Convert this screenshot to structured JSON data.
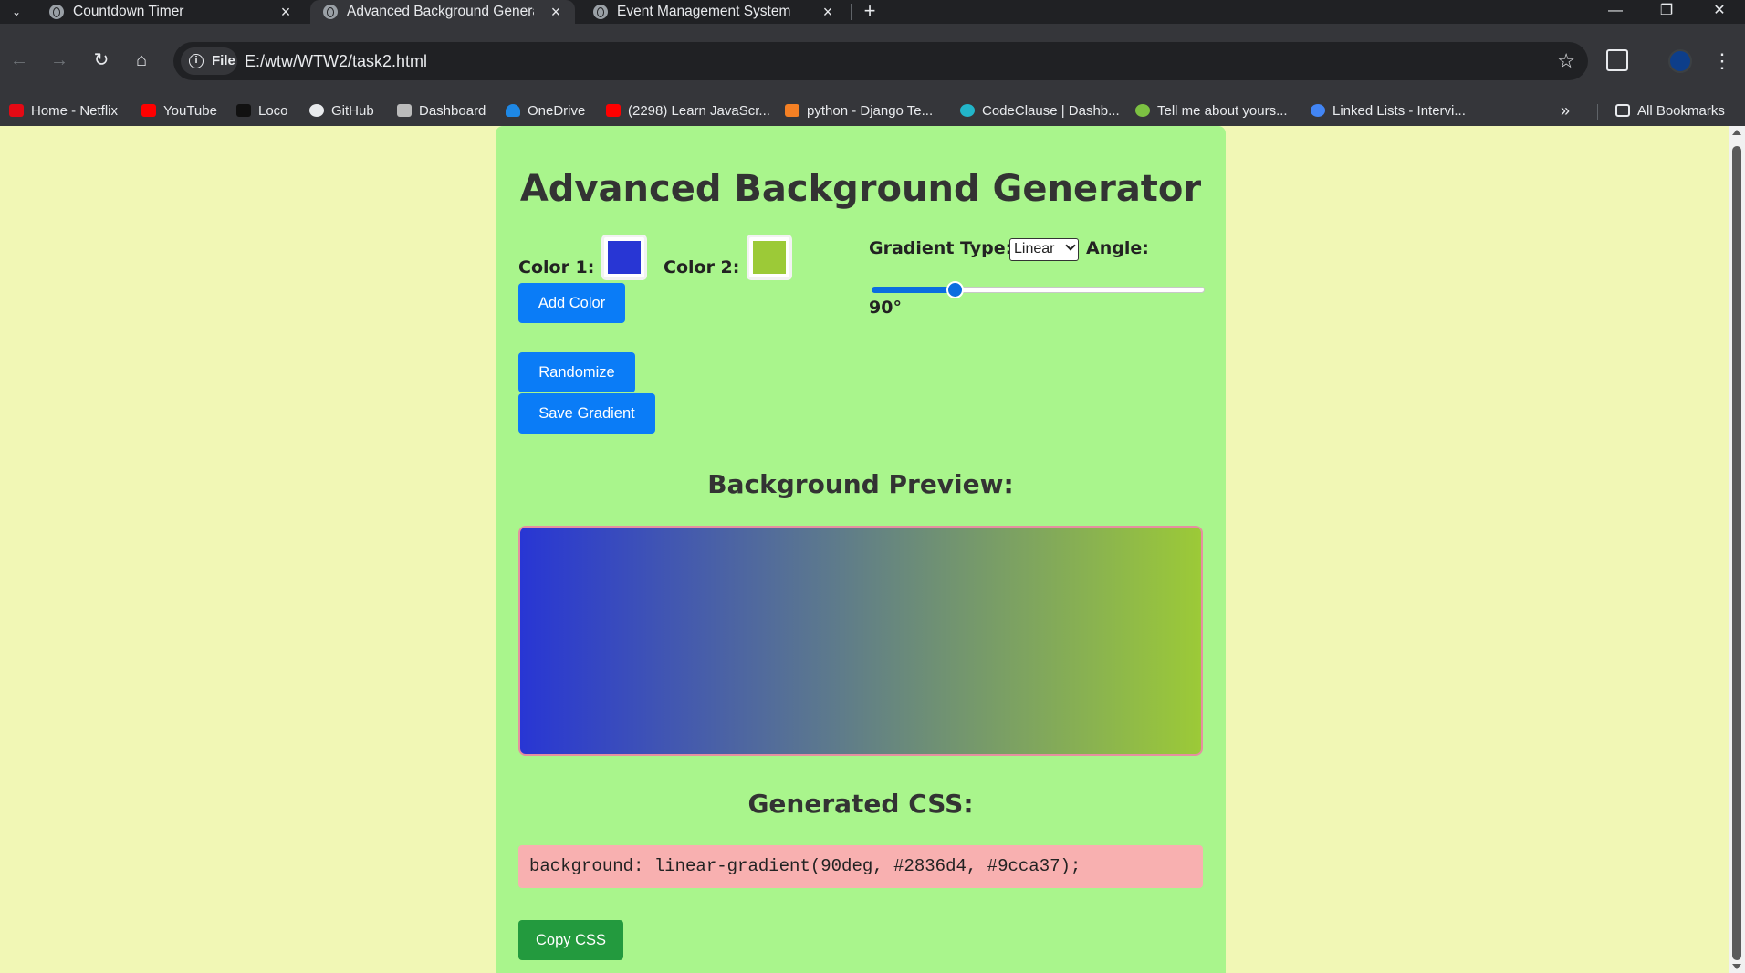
{
  "browser": {
    "tabs": [
      {
        "title": "Countdown Timer"
      },
      {
        "title": "Advanced Background Generat"
      },
      {
        "title": "Event Management System"
      }
    ],
    "omnibox": {
      "chip": "File",
      "url": "E:/wtw/WTW2/task2.html"
    },
    "bookmarks": [
      {
        "label": "Home - Netflix",
        "color": "#e50914"
      },
      {
        "label": "YouTube",
        "color": "#ff0000"
      },
      {
        "label": "Loco",
        "color": "#111111"
      },
      {
        "label": "GitHub",
        "color": "#e8eaed"
      },
      {
        "label": "Dashboard",
        "color": "#bbbbbb"
      },
      {
        "label": "OneDrive",
        "color": "#1e88e5"
      },
      {
        "label": "(2298) Learn JavaScr...",
        "color": "#ff0000"
      },
      {
        "label": "python - Django Te...",
        "color": "#f48024"
      },
      {
        "label": "CodeClause | Dashb...",
        "color": "#22b5c9"
      },
      {
        "label": "Tell me about yours...",
        "color": "#7cc142"
      },
      {
        "label": "Linked Lists - Intervi...",
        "color": "#4285f4"
      }
    ],
    "all_bookmarks": "All Bookmarks"
  },
  "app": {
    "title": "Advanced Background Generator",
    "color1_label": "Color 1:",
    "color1_value": "#2836d4",
    "color2_label": "Color 2:",
    "color2_value": "#9cca37",
    "gradient_type_label": "Gradient Type:",
    "gradient_type_value": "Linear",
    "angle_label": "Angle:",
    "angle_value": "90°",
    "angle_fraction": 0.25,
    "add_color_button": "Add Color",
    "randomize_button": "Randomize",
    "save_gradient_button": "Save Gradient",
    "preview_heading": "Background Preview:",
    "css_heading": "Generated CSS:",
    "css_output": "background: linear-gradient(90deg, #2836d4, #9cca37);",
    "copy_css_button": "Copy CSS"
  }
}
